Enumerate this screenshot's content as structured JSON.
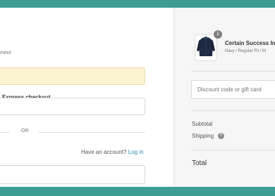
{
  "checkout": {
    "payment_label": "ment",
    "express_title": "Express checkout",
    "or_text": "OR",
    "account_prompt": "Have an account?",
    "login_link": "Log in"
  },
  "summary": {
    "quantity": "1",
    "product_title": "Certain Success In",
    "product_variant": "Navy / Regular Fit / M",
    "discount_placeholder": "Discount code or gift card",
    "subtotal_label": "Subtotal",
    "shipping_label": "Shipping",
    "help_icon": "?",
    "total_label": "Total"
  },
  "colors": {
    "accent_band": "#3d9c93",
    "link": "#2a8bb0",
    "express_highlight": "#fcf3cf"
  }
}
